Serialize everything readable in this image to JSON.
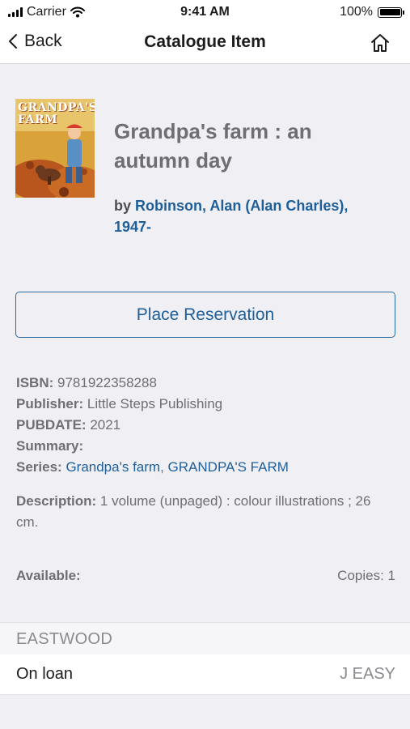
{
  "status_bar": {
    "carrier": "Carrier",
    "time": "9:41 AM",
    "battery": "100%",
    "battery_level": 1.0,
    "icons": [
      "signal-icon",
      "wifi-icon",
      "battery-icon"
    ]
  },
  "nav": {
    "back_label": "Back",
    "title": "Catalogue Item",
    "home_icon": "home-icon"
  },
  "book": {
    "cover_title": "GRANDPA'S FARM",
    "title": "Grandpa's farm : an autumn day",
    "by": "by",
    "author": "Robinson, Alan (Alan Charles), 1947-"
  },
  "actions": {
    "reserve_label": "Place Reservation"
  },
  "details": {
    "isbn_label": "ISBN:",
    "isbn": "9781922358288",
    "publisher_label": "Publisher:",
    "publisher": "Little Steps Publishing",
    "pubdate_label": "PUBDATE:",
    "pubdate": "2021",
    "summary_label": "Summary:",
    "series_label": "Series:",
    "series": [
      "Grandpa's farm",
      "GRANDPA'S FARM"
    ],
    "series_separator": ",",
    "description_label": "Description:",
    "description": "1 volume (unpaged) : colour illustrations ; 26 cm."
  },
  "availability": {
    "label": "Available:",
    "copies": "Copies: 1"
  },
  "branch": {
    "name": "EASTWOOD",
    "status": "On loan",
    "call_number": "J EASY"
  },
  "colors": {
    "link": "#1f5f99",
    "background": "#efeff4",
    "muted_text": "#6e6e73"
  }
}
